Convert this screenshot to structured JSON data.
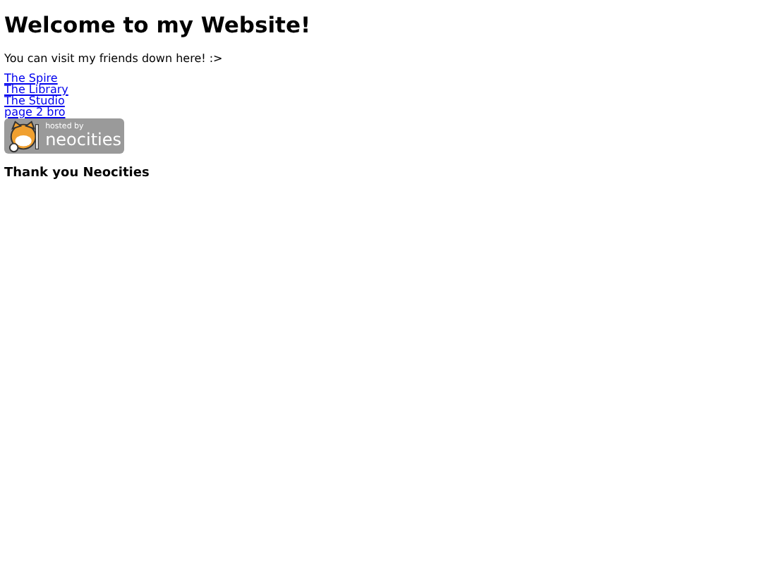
{
  "heading": "Welcome to my Website!",
  "intro": "You can visit my friends down here! :>",
  "links": [
    "The Spire",
    "The Library",
    "The Studio",
    "page 2 bro"
  ],
  "badge": {
    "caption": "hosted by",
    "name": "neocities"
  },
  "footer_heading": "Thank you Neocities"
}
